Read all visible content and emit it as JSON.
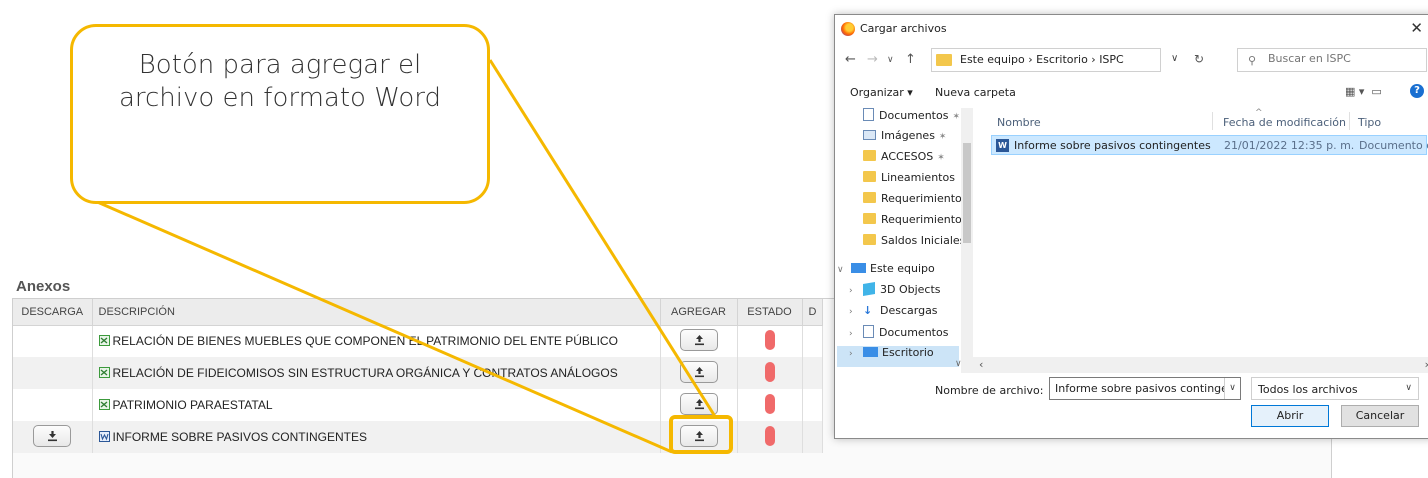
{
  "page": {
    "section_title": "Anexos",
    "columns": {
      "descarga": "DESCARGA",
      "descripcion": "DESCRIPCIÓN",
      "agregar": "AGREGAR",
      "estado": "ESTADO",
      "partial": "D"
    },
    "rows": [
      {
        "descripcion": "RELACIÓN DE BIENES MUEBLES QUE COMPONEN EL PATRIMONIO DEL ENTE PÚBLICO",
        "has_download": false
      },
      {
        "descripcion": "RELACIÓN DE FIDEICOMISOS SIN ESTRUCTURA ORGÁNICA Y CONTRATOS ANÁLOGOS",
        "has_download": false
      },
      {
        "descripcion": "PATRIMONIO PARAESTATAL",
        "has_download": false
      },
      {
        "descripcion": "INFORME SOBRE PASIVOS CONTINGENTES",
        "has_download": true
      }
    ],
    "status_color": "#f06a6a"
  },
  "callout": {
    "text": "Botón para agregar el archivo en formato Word",
    "color": "#f5b800"
  },
  "dialog": {
    "title": "Cargar archivos",
    "breadcrumb": "Este equipo  ›  Escritorio  ›  ISPC",
    "search_placeholder": "Buscar en ISPC",
    "organize_label": "Organizar ▾",
    "new_folder_label": "Nueva carpeta",
    "nav_items": [
      {
        "label": "Documentos",
        "icon": "doc-icon",
        "pinned": true
      },
      {
        "label": "Imágenes",
        "icon": "image-icon",
        "pinned": true
      },
      {
        "label": "ACCESOS",
        "icon": "folder-icon",
        "pinned": true
      },
      {
        "label": "Lineamientos",
        "icon": "folder-icon",
        "pinned": false
      },
      {
        "label": "Requerimiento",
        "icon": "folder-icon",
        "pinned": false
      },
      {
        "label": "Requerimientos",
        "icon": "folder-icon",
        "pinned": false
      },
      {
        "label": "Saldos Iniciales",
        "icon": "folder-icon",
        "pinned": false
      },
      {
        "label": "Este equipo",
        "icon": "pc-icon",
        "pinned": false
      },
      {
        "label": "3D Objects",
        "icon": "cube-icon",
        "pinned": false
      },
      {
        "label": "Descargas",
        "icon": "download-icon",
        "pinned": false
      },
      {
        "label": "Documentos",
        "icon": "doc-icon",
        "pinned": false
      },
      {
        "label": "Escritorio",
        "icon": "desktop-icon",
        "pinned": false
      }
    ],
    "file_columns": {
      "name": "Nombre",
      "modified": "Fecha de modificación",
      "type": "Tipo"
    },
    "file": {
      "name": "Informe sobre pasivos contingentes",
      "modified": "21/01/2022 12:35 p. m.",
      "type": "Documento de"
    },
    "filename_label": "Nombre de archivo:",
    "filename_value": "Informe sobre pasivos contingentes",
    "filter_value": "Todos los archivos",
    "open_label": "Abrir",
    "cancel_label": "Cancelar"
  }
}
